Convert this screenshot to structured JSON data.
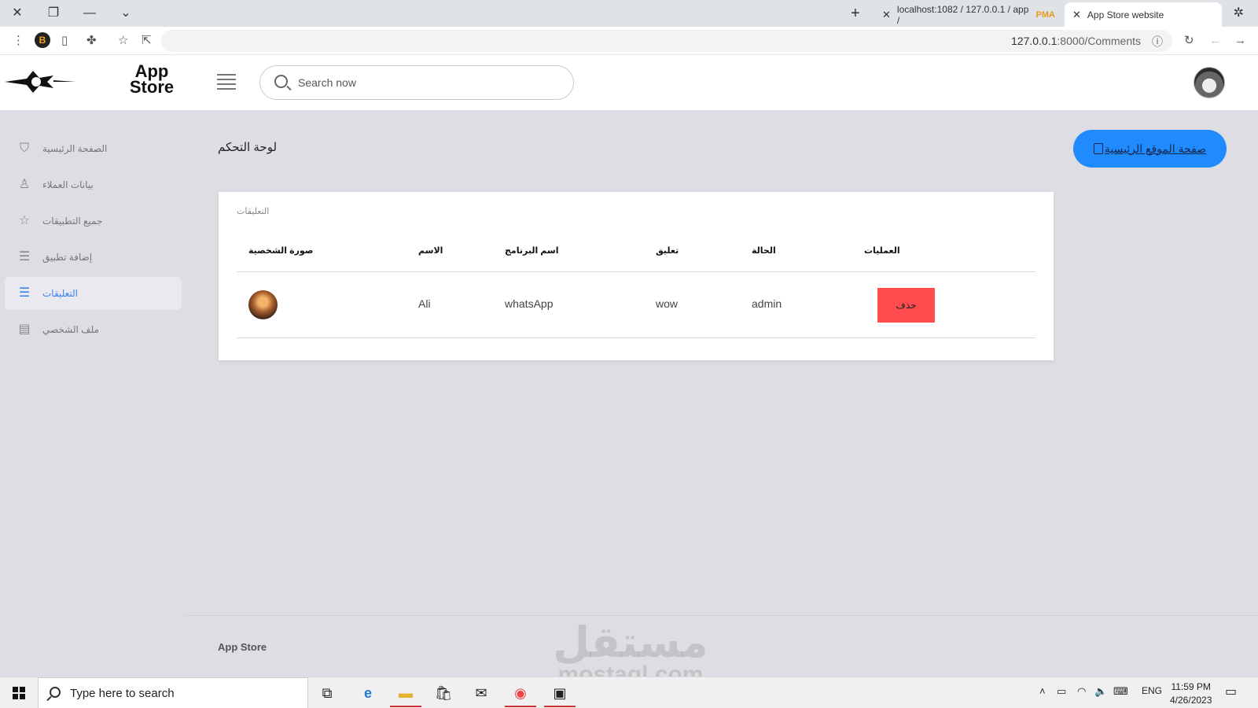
{
  "browser": {
    "tabs": [
      {
        "title": "localhost:1082 / 127.0.0.1 / app /",
        "icon": "phpmyadmin-icon"
      },
      {
        "title": "App Store website",
        "icon": "close-icon"
      }
    ],
    "url_host": "127.0.0.1",
    "url_path": ":8000/Comments"
  },
  "header": {
    "brand_line1": "App",
    "brand_line2": "Store",
    "search_placeholder": "Search now"
  },
  "sidebar": {
    "items": [
      {
        "label": "الصفحة الرئيسية",
        "icon": "shield-icon",
        "active": false
      },
      {
        "label": "بيانات العملاء",
        "icon": "user-icon",
        "active": false
      },
      {
        "label": "جميع التطبيقات",
        "icon": "star-icon",
        "active": false
      },
      {
        "label": "إضافة تطبيق",
        "icon": "list-icon",
        "active": false
      },
      {
        "label": "التعليقات",
        "icon": "list-icon",
        "active": true
      },
      {
        "label": "ملف الشخصي",
        "icon": "book-icon",
        "active": false
      }
    ]
  },
  "main": {
    "page_title": "لوحة التحكم",
    "home_button_label": "صفحة الموقع الرئيسية",
    "card_title": "التعليقات",
    "columns": [
      "صورة الشخصية",
      "الاسم",
      "اسم البرنامج",
      "تعليق",
      "الحالة",
      "العمليات"
    ],
    "rows": [
      {
        "name": "Ali",
        "app": "whatsApp",
        "comment": "wow",
        "status": "admin",
        "action": "حذف"
      }
    ]
  },
  "footer": {
    "brand": "App Store",
    "watermark_ar": "مستقل",
    "watermark_lat": "mostaql.com"
  },
  "taskbar": {
    "search_placeholder": "Type here to search",
    "language": "ENG",
    "time": "11:59 PM",
    "date": "4/26/2023"
  },
  "colors": {
    "accent": "#1f8bff",
    "danger": "#ff4d4f",
    "sidebar_active_text": "#3b82f6"
  }
}
